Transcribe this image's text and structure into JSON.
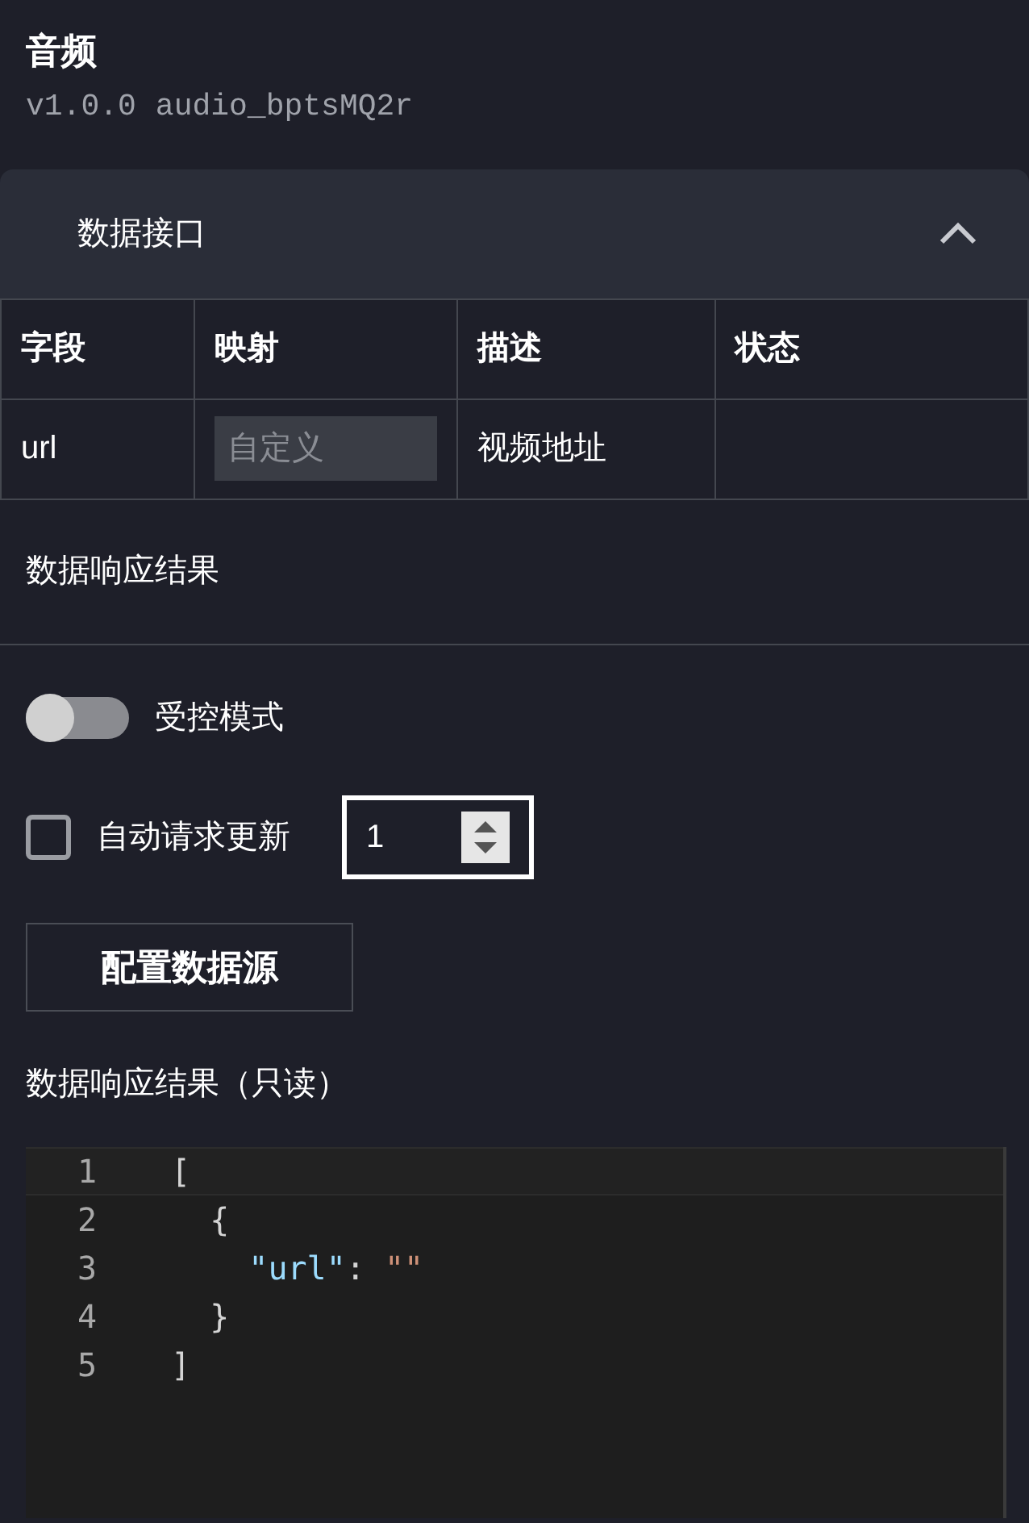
{
  "header": {
    "title": "音频",
    "version": "v1.0.0",
    "component_id": "audio_bptsMQ2r"
  },
  "data_interface": {
    "title": "数据接口",
    "expanded": true,
    "table": {
      "columns": [
        "字段",
        "映射",
        "描述",
        "状态"
      ],
      "rows": [
        {
          "field": "url",
          "mapping_placeholder": "自定义",
          "description": "视频地址"
        }
      ]
    }
  },
  "response_section": {
    "title": "数据响应结果"
  },
  "controlled_mode": {
    "label": "受控模式",
    "on": false
  },
  "auto_update": {
    "label": "自动请求更新",
    "checked": false,
    "interval": "1"
  },
  "configure_button": "配置数据源",
  "result": {
    "title": "数据响应结果（只读）",
    "lines": [
      {
        "number": "1",
        "tokens": [
          {
            "kind": "punct",
            "text": "["
          }
        ]
      },
      {
        "number": "2",
        "tokens": [
          {
            "kind": "punct",
            "text": "  {"
          }
        ]
      },
      {
        "number": "3",
        "tokens": [
          {
            "kind": "key",
            "text": "    \"url\""
          },
          {
            "kind": "punct",
            "text": ": "
          },
          {
            "kind": "string",
            "text": "\"\""
          }
        ]
      },
      {
        "number": "4",
        "tokens": [
          {
            "kind": "punct",
            "text": "  }"
          }
        ]
      },
      {
        "number": "5",
        "tokens": [
          {
            "kind": "punct",
            "text": "]"
          }
        ]
      }
    ]
  }
}
